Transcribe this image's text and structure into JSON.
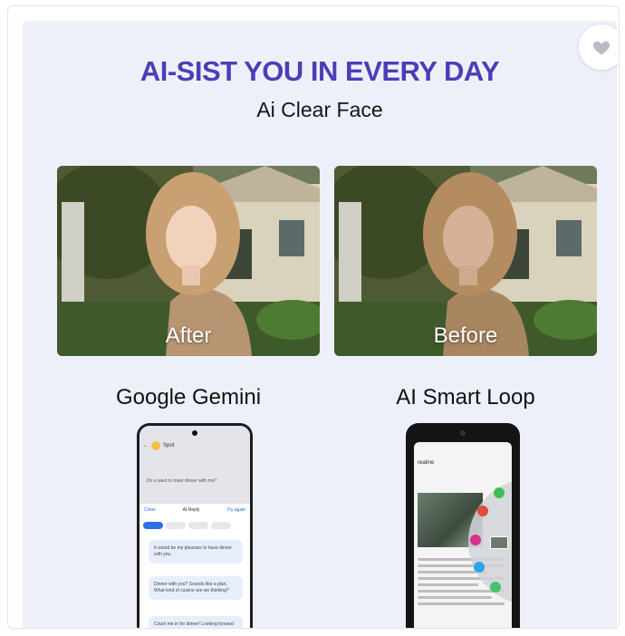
{
  "banner": {
    "headline": "AI-SIST YOU IN EVERY DAY",
    "subline": "Ai Clear Face"
  },
  "photos": {
    "after_label": "After",
    "before_label": "Before"
  },
  "features": {
    "left_title": "Google Gemini",
    "right_title": "AI Smart Loop"
  },
  "favorite": {
    "icon": "heart-icon"
  },
  "gemini_screen": {
    "search_label": "Spot",
    "message": "Do u want to meet dinner with me?",
    "bar_left": "Close",
    "bar_center": "AI Reply",
    "bar_right": "Try again",
    "bubbles": [
      "It would be my pleasure to have dinner with you.",
      "Dinner with you? Sounds like a plan. What kind of cuisine are we thinking?",
      "Count me in for dinner! Looking forward to it for you."
    ]
  },
  "loop_screen": {
    "header": "realme"
  },
  "colors": {
    "headline": "#4a3fb8",
    "banner_bg": "#eef0f9",
    "chip_active": "#2f6fe6"
  }
}
